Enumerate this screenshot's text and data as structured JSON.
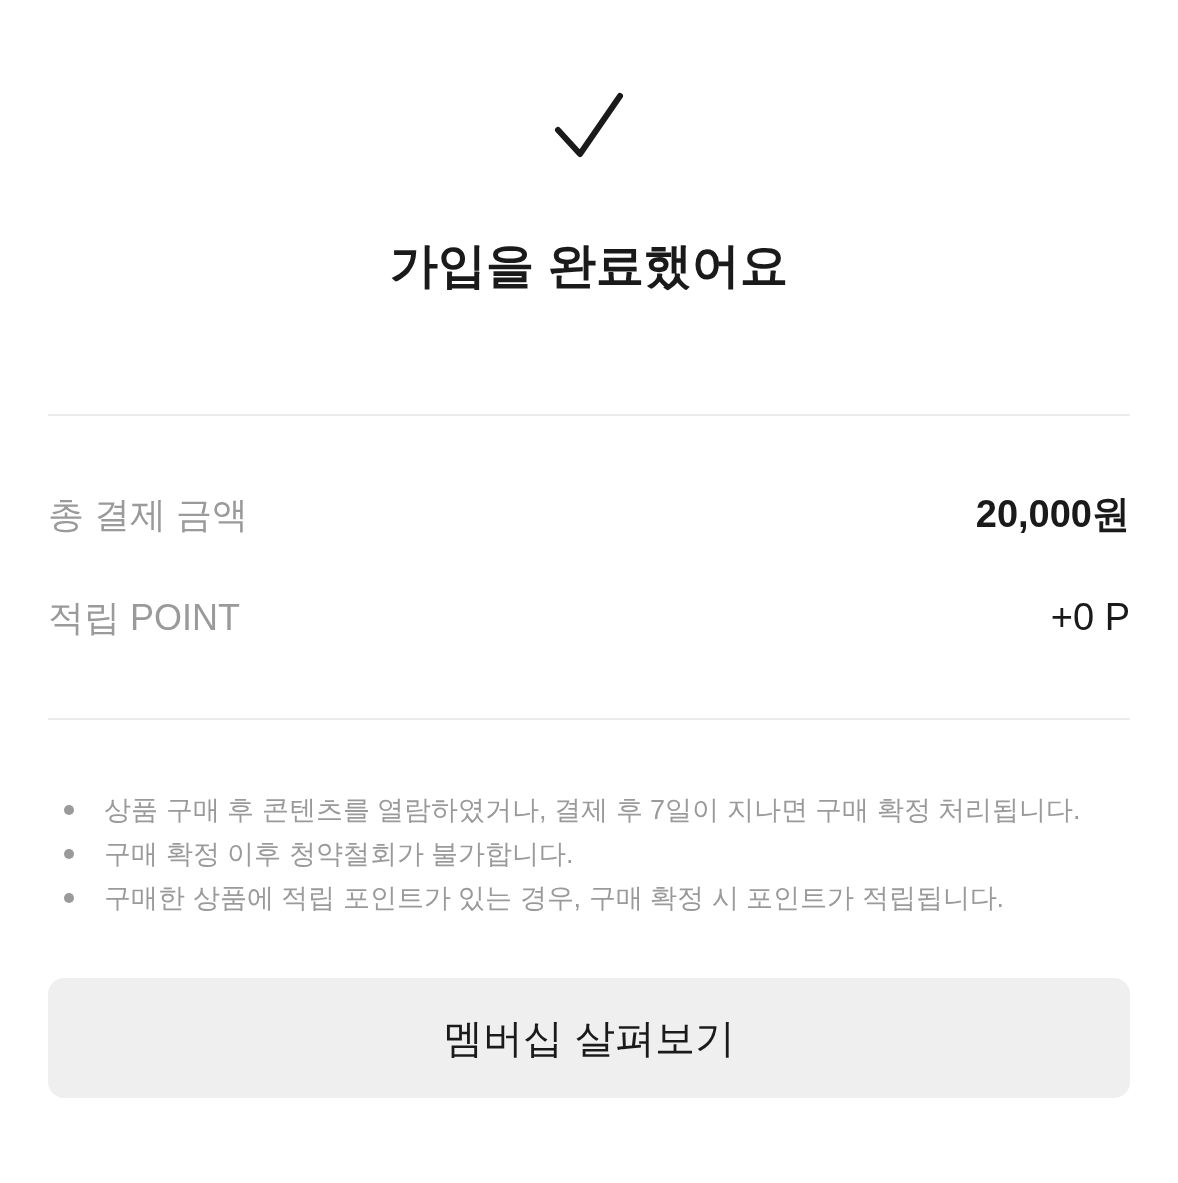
{
  "title": "가입을 완료했어요",
  "summary": [
    {
      "label": "총 결제 금액",
      "value": "20,000원",
      "kind": "total"
    },
    {
      "label": "적립 POINT",
      "value": "+0 P",
      "kind": "point"
    }
  ],
  "notes": [
    "상품 구매 후 콘텐츠를 열람하였거나, 결제 후 7일이 지나면 구매 확정 처리됩니다.",
    "구매 확정 이후 청약철회가 불가합니다.",
    "구매한 상품에 적립 포인트가 있는 경우, 구매 확정 시 포인트가 적립됩니다."
  ],
  "button": "멤버십 살펴보기"
}
